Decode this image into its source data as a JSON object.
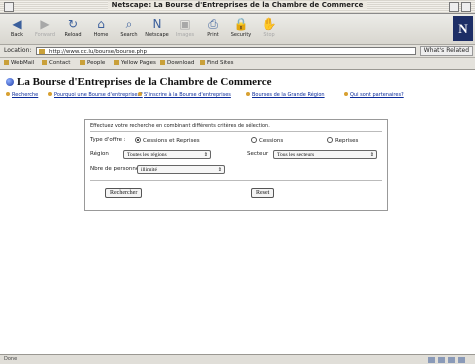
{
  "window": {
    "title": "Netscape: La Bourse d'Entreprises de la Chambre de Commerce"
  },
  "toolbar": {
    "buttons": [
      {
        "label": "Back",
        "icon": "back-arrow-icon",
        "glyph": "◀",
        "enabled": true
      },
      {
        "label": "Forward",
        "icon": "forward-arrow-icon",
        "glyph": "▶",
        "enabled": false
      },
      {
        "label": "Reload",
        "icon": "reload-icon",
        "glyph": "↻",
        "enabled": true
      },
      {
        "label": "Home",
        "icon": "home-icon",
        "glyph": "⌂",
        "enabled": true
      },
      {
        "label": "Search",
        "icon": "search-icon",
        "glyph": "⌕",
        "enabled": true
      },
      {
        "label": "Netscape",
        "icon": "netscape-icon",
        "glyph": "N",
        "enabled": true
      },
      {
        "label": "Images",
        "icon": "images-icon",
        "glyph": "▣",
        "enabled": false
      },
      {
        "label": "Print",
        "icon": "print-icon",
        "glyph": "⎙",
        "enabled": true
      },
      {
        "label": "Security",
        "icon": "security-lock-icon",
        "glyph": "🔒",
        "enabled": true
      },
      {
        "label": "Stop",
        "icon": "stop-icon",
        "glyph": "✋",
        "enabled": false
      }
    ],
    "logo": "N"
  },
  "location": {
    "label": "Location:",
    "url": "http://www.cc.lu/bourse/bourse.php",
    "related": "What's Related"
  },
  "personal_bar": [
    "WebMail",
    "Contact",
    "People",
    "Yellow Pages",
    "Download",
    "Find Sites"
  ],
  "page": {
    "title": "La Bourse d'Entreprises de la Chambre de Commerce",
    "nav_links": [
      "Recherche",
      "Pourquoi une Bourse d'entreprises?",
      "S'inscrire à la Bourse d'entreprises",
      "Bourses de la Grande Région",
      "Qui sont partenaires?"
    ],
    "form": {
      "intro": "Effectuez votre recherche en combinant différents critères de sélection.",
      "type_label": "Type d'offre :",
      "type_options": [
        {
          "label": "Cessions et Reprises",
          "checked": true
        },
        {
          "label": "Cessions",
          "checked": false
        },
        {
          "label": "Reprises",
          "checked": false
        }
      ],
      "region_label": "Région",
      "region_value": "Toutes les régions",
      "sector_label": "Secteur",
      "sector_value": "Tous les secteurs",
      "employees_label": "Nbre de personnes",
      "employees_value": "illimité",
      "search_button": "Rechercher",
      "reset_button": "Reset"
    }
  },
  "status": {
    "text": "Done"
  }
}
